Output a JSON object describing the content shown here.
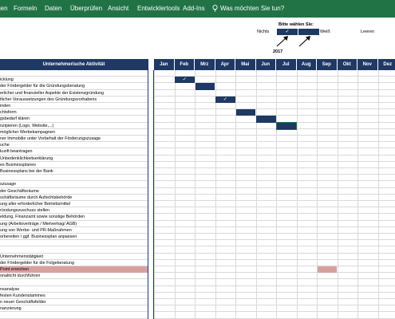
{
  "ribbon": {
    "tabs": [
      "Einfügen",
      "Formeln",
      "Daten",
      "Überprüfen",
      "Ansicht",
      "Entwicklertools",
      "Add-Ins"
    ],
    "tell_me": "Was möchten Sie tun?",
    "color": "#217346"
  },
  "legend": {
    "title": "Bitte wählen Sie:",
    "nichts": "Nichts",
    "weiss": "Weiß",
    "leeren": "Leeren",
    "check": "✓",
    "color": "#1f3864"
  },
  "year": "2017",
  "header": {
    "activity": "Unternehmerische Aktivität",
    "months": [
      "Jan",
      "Feb",
      "Mrz",
      "Apr",
      "Mai",
      "Jun",
      "Jul",
      "Aug",
      "Sep",
      "Okt",
      "Nov",
      "Dez"
    ]
  },
  "rows": [
    "",
    "icklung",
    " der Fördergelder für die Gründungsberatung",
    "erlicher und finanzieller Aspekte der Existenzgründung",
    "tlicher Voraussetzungen des Gründungsvorhabens",
    "inden",
    "chtsform",
    "gsbedarf klären",
    "nzipieren (Logo, Website,...)",
    " möglicher Werbekampagnen",
    "ner Immobilie unter Vorbehalt der Förderungszusage",
    "uche",
    "kunft beantragen",
    "Unbedenklichkeitserklärung",
    "es Businessplanes",
    " Businessplans bei der Bank",
    "",
    "szusage",
    "der Geschäftsräume",
    "schäftsräume durch Aufsichtsbehörde",
    "ung aller erforderlicher Betriebsmittel",
    "ründungszuschuss stellen",
    "eldung, Finanzamt sowie sonstige Behörden",
    "ung (Arbeitsverträge / Mietvertrag/ AGB)",
    "ung von Werbe- und PR-Maßnahmen",
    "orbereiten / ggf. Businessplan anpassen",
    "",
    "",
    "Unternehmenstätigkeit",
    " der Fördergelder für die Folgeberatung",
    "Point erreichen",
    "onalitcht durchführen",
    "",
    "nsanalyse",
    " festen Kundenstammes",
    "n neuer Geschäftsfelder",
    "nanzierung",
    ""
  ],
  "highlighted_row": 30,
  "highlight_color": "#d9a0a0",
  "bars": [
    {
      "row": 1,
      "month": "Feb",
      "check": "✓"
    },
    {
      "row": 2,
      "month": "Mrz",
      "check": ""
    },
    {
      "row": 4,
      "month": "Apr",
      "check": "✓"
    },
    {
      "row": 6,
      "month": "Mai",
      "check": ""
    },
    {
      "row": 7,
      "month": "Jun",
      "check": ""
    },
    {
      "row": 8,
      "month": "Jul",
      "check": "",
      "selected": true
    },
    {
      "row": 30,
      "month": "Sep",
      "check": "",
      "pink": true
    }
  ]
}
